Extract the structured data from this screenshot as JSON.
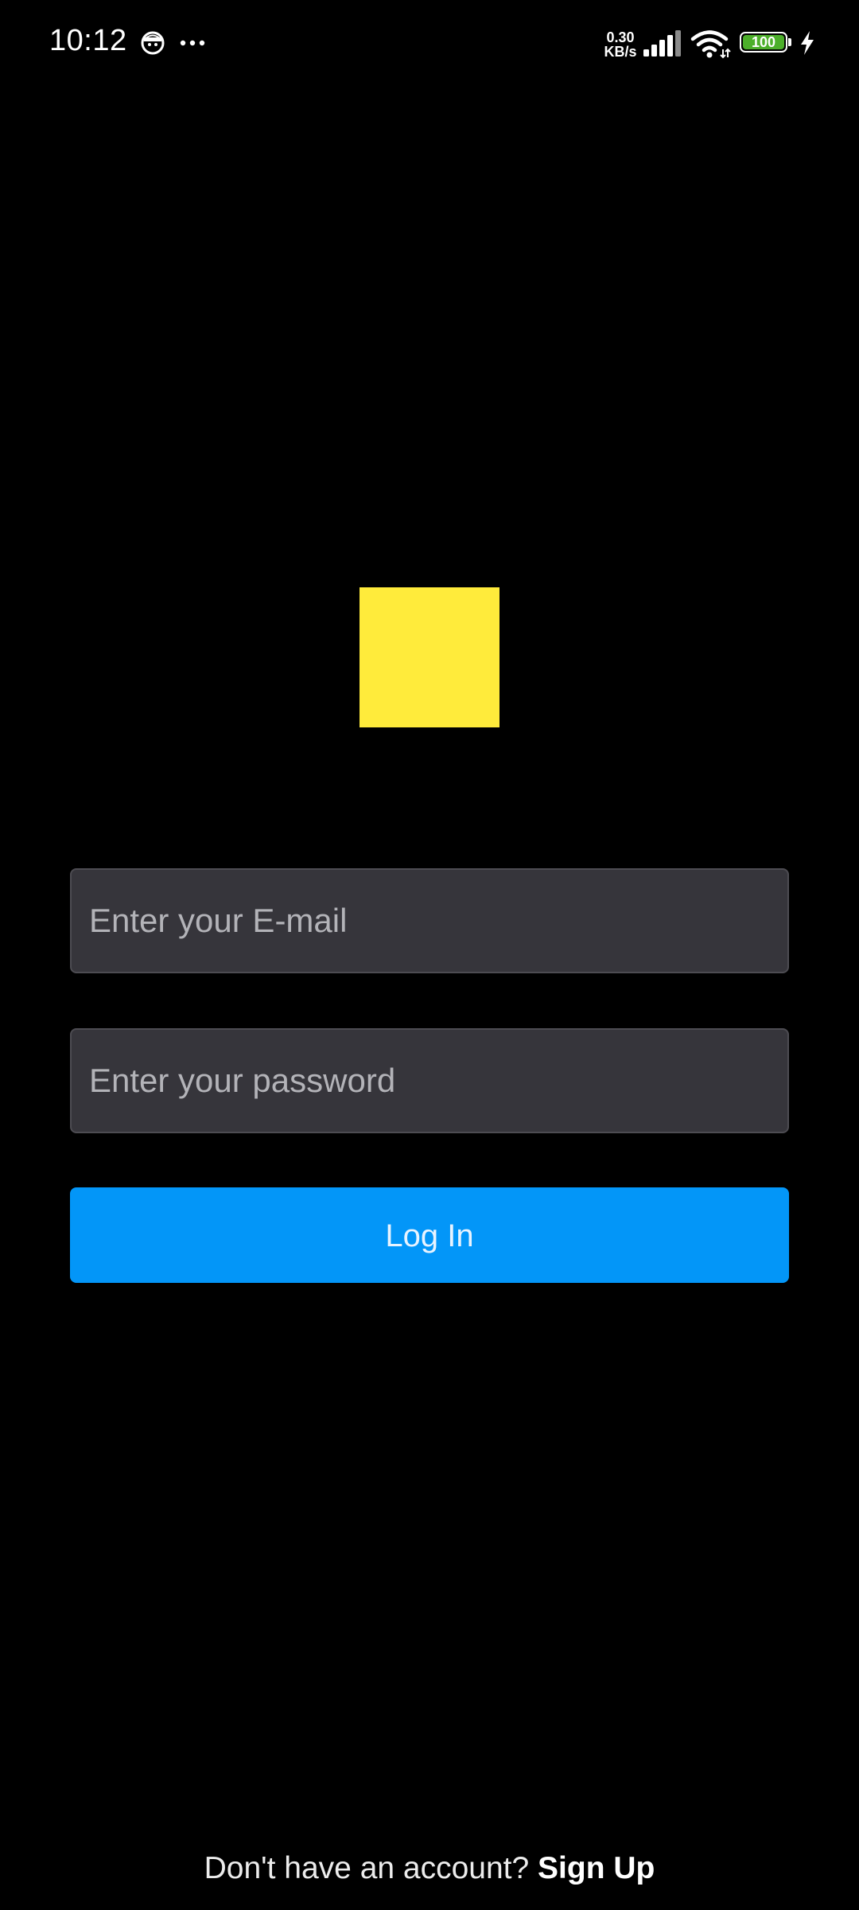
{
  "status_bar": {
    "time": "10:12",
    "net_speed_value": "0.30",
    "net_speed_unit": "KB/s",
    "battery_level": "100",
    "icons": [
      "face-icon",
      "more-dots-icon",
      "signal-icon",
      "wifi-icon",
      "battery-icon",
      "charging-icon"
    ]
  },
  "logo": {
    "color": "#ffeb3b"
  },
  "login_form": {
    "email_placeholder": "Enter your E-mail",
    "password_placeholder": "Enter your password",
    "login_label": "Log In",
    "login_color": "#0396f8",
    "field_background": "#36353b"
  },
  "footer": {
    "prompt": "Don't have an account?",
    "signup_label": "Sign Up"
  }
}
